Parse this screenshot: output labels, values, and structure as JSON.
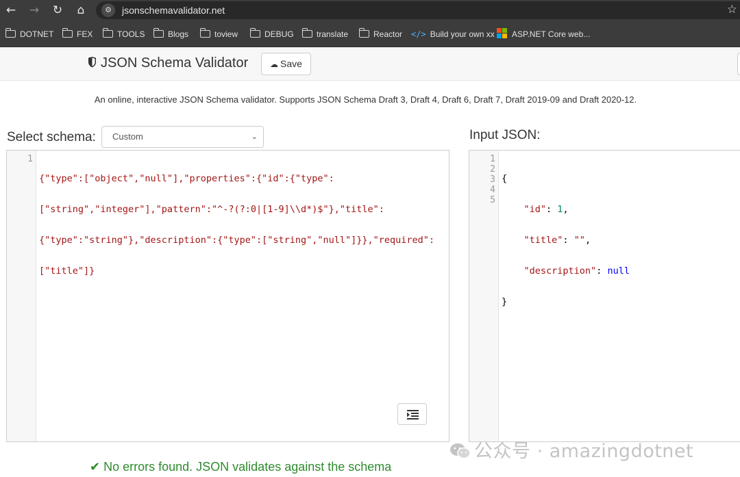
{
  "browser": {
    "url": "jsonschemavalidator.net",
    "nav": {
      "back": "←",
      "forward": "→",
      "reload": "↻",
      "home": "⌂"
    },
    "bookmarks": [
      {
        "label": "DOTNET",
        "icon": "folder-icon"
      },
      {
        "label": "FEX",
        "icon": "folder-icon"
      },
      {
        "label": "TOOLS",
        "icon": "folder-icon"
      },
      {
        "label": "Blogs",
        "icon": "folder-icon"
      },
      {
        "label": "toview",
        "icon": "folder-icon"
      },
      {
        "label": "DEBUG",
        "icon": "folder-icon"
      },
      {
        "label": "translate",
        "icon": "folder-icon"
      },
      {
        "label": "Reactor",
        "icon": "folder-icon"
      },
      {
        "label": "Build your own xx",
        "icon": "code-icon"
      },
      {
        "label": "ASP.NET Core web...",
        "icon": "microsoft-icon"
      }
    ]
  },
  "header": {
    "title": "JSON Schema Validator",
    "save_label": "Save"
  },
  "description": "An online, interactive JSON Schema validator. Supports JSON Schema Draft 3, Draft 4, Draft 6, Draft 7, Draft 2019-09 and Draft 2020-12.",
  "schema": {
    "select_label": "Select schema:",
    "selected_option": "Custom",
    "line_numbers": [
      "1"
    ],
    "code_lines": [
      "{\"type\":[\"object\",\"null\"],\"properties\":{\"id\":{\"type\":",
      "[\"string\",\"integer\"],\"pattern\":\"^-?(?:0|[1-9]\\\\d*)$\"},\"title\":",
      "{\"type\":\"string\"},\"description\":{\"type\":[\"string\",\"null\"]}},\"required\":",
      "[\"title\"]}"
    ]
  },
  "input": {
    "label": "Input JSON:",
    "line_numbers": [
      "1",
      "2",
      "3",
      "4",
      "5"
    ],
    "lines": [
      {
        "text": "{"
      },
      {
        "key": "\"id\"",
        "value": "1",
        "value_type": "number",
        "suffix": ","
      },
      {
        "key": "\"title\"",
        "value": "\"\"",
        "value_type": "string",
        "suffix": ","
      },
      {
        "key": "\"description\"",
        "value": "null",
        "value_type": "null",
        "suffix": ""
      },
      {
        "text": "}"
      }
    ]
  },
  "status": "No errors found. JSON validates against the schema",
  "watermark": "公众号 · amazingdotnet",
  "colors": {
    "chrome_bg": "#3c3c3c",
    "success_green": "#2e8b2e",
    "string_red": "#a31515",
    "number_green": "#098658",
    "keyword_blue": "#0000ff"
  }
}
